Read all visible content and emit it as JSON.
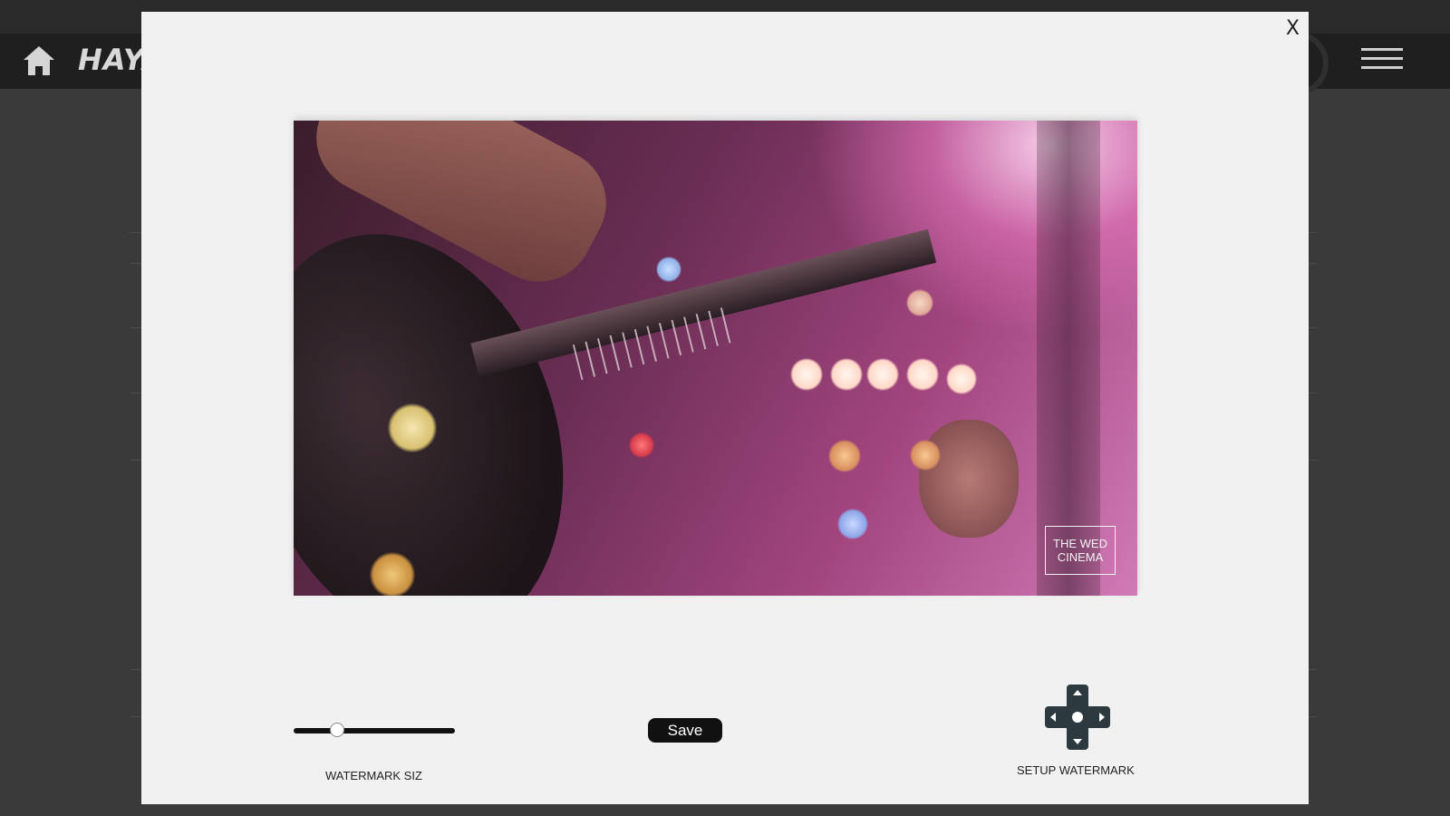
{
  "background": {
    "logo_text": "HAYA",
    "icons": [
      "home-icon",
      "menu-icon"
    ]
  },
  "modal": {
    "close_label": "X",
    "watermark_text_line1": "THE WED",
    "watermark_text_line2": "CINEMA",
    "slider": {
      "label": "WATERMARK SIZ",
      "value_fraction": 0.27
    },
    "save_label": "Save",
    "setup_label": "SETUP WATERMARK",
    "dpad_icon": "dpad-icon"
  },
  "colors": {
    "modal_bg": "#f1f1f1",
    "button": "#111111",
    "page_bg": "#3a3a3a"
  }
}
